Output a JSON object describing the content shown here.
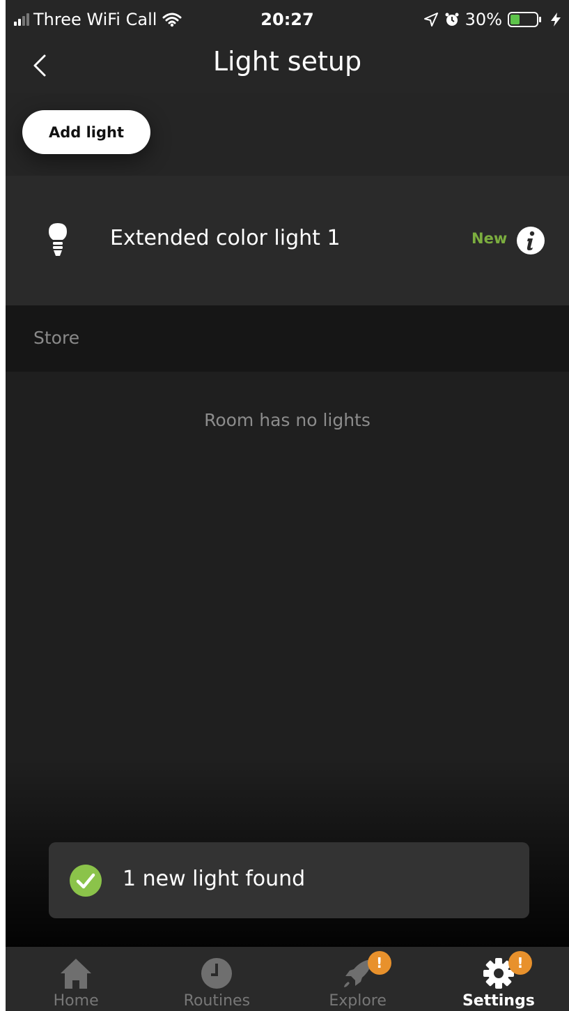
{
  "status_bar": {
    "carrier": "Three WiFi Call",
    "time": "20:27",
    "battery": "30%"
  },
  "header": {
    "title": "Light setup"
  },
  "actions": {
    "add_light_label": "Add light"
  },
  "lights": [
    {
      "name": "Extended color light 1",
      "badge": "New"
    }
  ],
  "section": {
    "title": "Store",
    "empty_message": "Room has no lights"
  },
  "toast": {
    "message": "1 new light found"
  },
  "tabs": [
    {
      "label": "Home",
      "active": false
    },
    {
      "label": "Routines",
      "active": false
    },
    {
      "label": "Explore",
      "active": false,
      "badge": "!"
    },
    {
      "label": "Settings",
      "active": true,
      "badge": "!"
    }
  ],
  "colors": {
    "accent_new": "#7cae3f",
    "badge": "#e8912c",
    "check": "#8bc34a",
    "background": "#1f1f1f"
  },
  "icons": {
    "back": "chevron-left-icon",
    "bulb": "bulb-icon",
    "info": "info-icon",
    "toast": "check-circle-icon",
    "home": "home-icon",
    "routines": "clock-icon",
    "explore": "rocket-icon",
    "settings": "gear-icon"
  }
}
